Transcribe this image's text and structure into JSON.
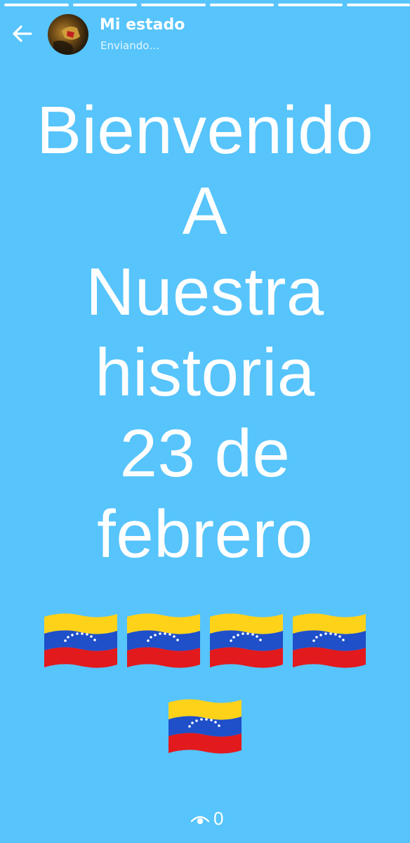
{
  "header": {
    "title": "Mi estado",
    "subtitle": "Enviando…",
    "back_icon": "arrow-left-icon",
    "avatar": "profile-avatar"
  },
  "progress_segments": 6,
  "status_text": {
    "lines": [
      "Bienvenido",
      "A",
      "Nuestra",
      "historia",
      "23 de",
      "febrero"
    ]
  },
  "flags": {
    "emoji": "venezuela-flag-icon",
    "count": 5,
    "colors": {
      "yellow": "#ffd21a",
      "blue": "#1f4fc9",
      "red": "#e2191d"
    }
  },
  "footer": {
    "views_icon": "eye-icon",
    "views_count": "0"
  },
  "colors": {
    "background": "#57c4fb",
    "text": "#ffffff"
  }
}
